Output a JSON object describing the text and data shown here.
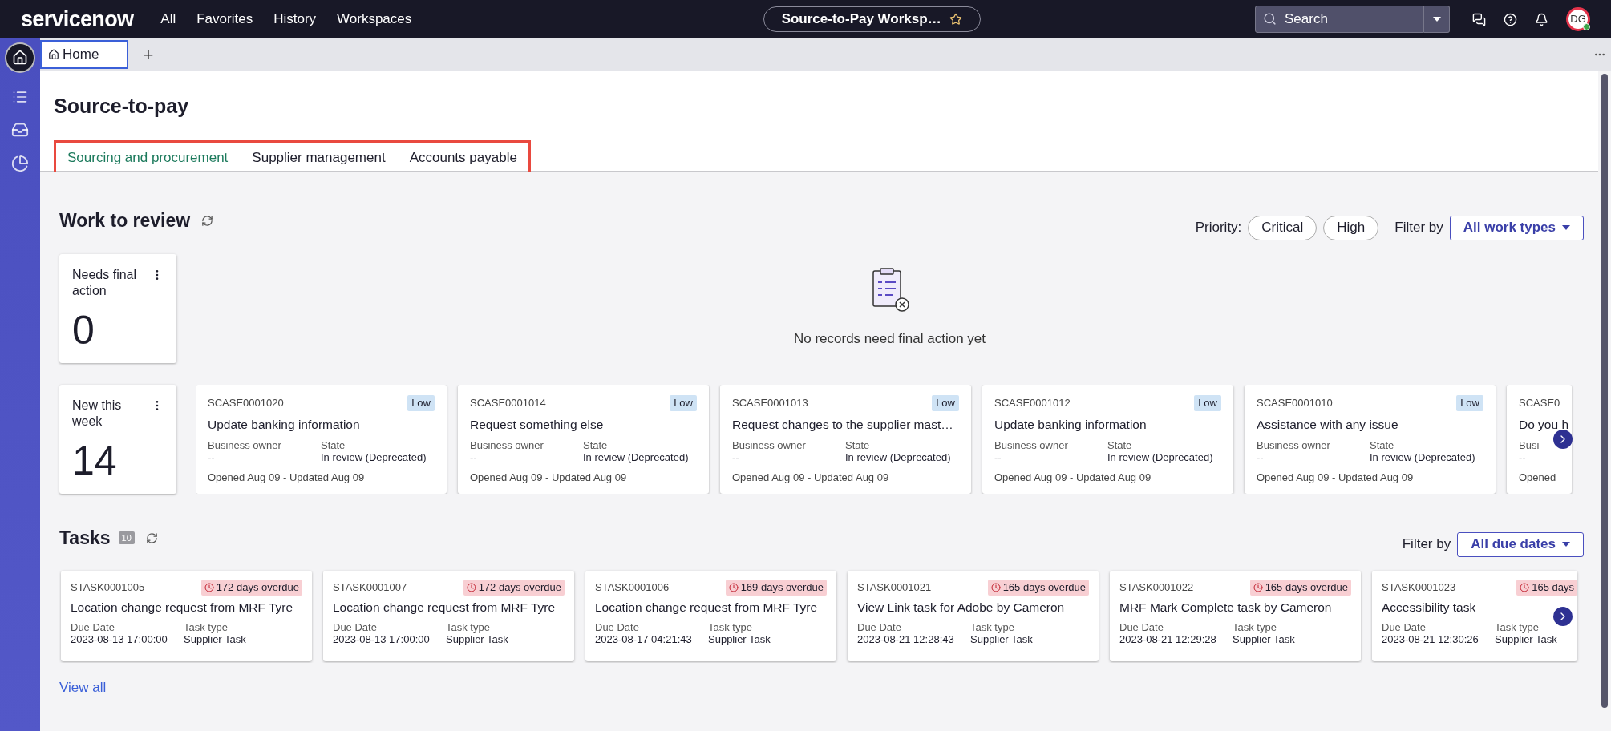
{
  "topbar": {
    "logo": "servicenow",
    "nav": [
      "All",
      "Favorites",
      "History",
      "Workspaces"
    ],
    "workspace": "Source-to-Pay Worksp…",
    "search": {
      "placeholder": "Search"
    },
    "avatar": "DG"
  },
  "tabstrip": {
    "tabs": [
      {
        "label": "Home",
        "selected": true
      }
    ],
    "add": "+"
  },
  "page": {
    "title": "Source-to-pay",
    "tabs": [
      {
        "label": "Sourcing and procurement",
        "selected": true
      },
      {
        "label": "Supplier management",
        "selected": false
      },
      {
        "label": "Accounts payable",
        "selected": false
      }
    ]
  },
  "work_to_review": {
    "title": "Work to review",
    "priority_label": "Priority:",
    "priority": [
      {
        "label": "Critical",
        "selected": false
      },
      {
        "label": "High",
        "selected": false
      }
    ],
    "filter_label": "Filter by",
    "filter": "All work types",
    "metrics": [
      {
        "label": "Needs final action",
        "value": "0"
      },
      {
        "label": "New this week",
        "value": "14"
      }
    ],
    "empty_message": "No records need final action yet",
    "cases": [
      {
        "id": "SCASE0001020",
        "priority": "Low",
        "title": "Update banking information",
        "owner_label": "Business owner",
        "owner": "--",
        "state_label": "State",
        "state": "In review (Deprecated)",
        "footer": "Opened Aug 09 - Updated Aug 09",
        "clipped": false
      },
      {
        "id": "SCASE0001014",
        "priority": "Low",
        "title": "Request something else",
        "owner_label": "Business owner",
        "owner": "--",
        "state_label": "State",
        "state": "In review (Deprecated)",
        "footer": "Opened Aug 09 - Updated Aug 09",
        "clipped": false
      },
      {
        "id": "SCASE0001013",
        "priority": "Low",
        "title": "Request changes to the supplier mast…",
        "owner_label": "Business owner",
        "owner": "--",
        "state_label": "State",
        "state": "In review (Deprecated)",
        "footer": "Opened Aug 09 - Updated Aug 09",
        "clipped": false
      },
      {
        "id": "SCASE0001012",
        "priority": "Low",
        "title": "Update banking information",
        "owner_label": "Business owner",
        "owner": "--",
        "state_label": "State",
        "state": "In review (Deprecated)",
        "footer": "Opened Aug 09 - Updated Aug 09",
        "clipped": false
      },
      {
        "id": "SCASE0001010",
        "priority": "Low",
        "title": "Assistance with any issue",
        "owner_label": "Business owner",
        "owner": "--",
        "state_label": "State",
        "state": "In review (Deprecated)",
        "footer": "Opened Aug 09 - Updated Aug 09",
        "clipped": false
      },
      {
        "id": "SCASE0",
        "title": "Do you h",
        "owner_label": "Busi",
        "owner": "--",
        "footer": "Opened",
        "clipped": true
      }
    ]
  },
  "tasks": {
    "title": "Tasks",
    "count": "10",
    "filter_label": "Filter by",
    "filter": "All due dates",
    "items": [
      {
        "id": "STASK0001005",
        "overdue": "172 days overdue",
        "title": "Location change request from MRF Tyre",
        "due_label": "Due Date",
        "due": "2023-08-13 17:00:00",
        "type_label": "Task type",
        "type": "Supplier Task",
        "clipped": false
      },
      {
        "id": "STASK0001007",
        "overdue": "172 days overdue",
        "title": "Location change request from MRF Tyre",
        "due_label": "Due Date",
        "due": "2023-08-13 17:00:00",
        "type_label": "Task type",
        "type": "Supplier Task",
        "clipped": false
      },
      {
        "id": "STASK0001006",
        "overdue": "169 days overdue",
        "title": "Location change request from MRF Tyre",
        "due_label": "Due Date",
        "due": "2023-08-17 04:21:43",
        "type_label": "Task type",
        "type": "Supplier Task",
        "clipped": false
      },
      {
        "id": "STASK0001021",
        "overdue": "165 days overdue",
        "title": "View Link task for Adobe by Cameron",
        "due_label": "Due Date",
        "due": "2023-08-21 12:28:43",
        "type_label": "Task type",
        "type": "Supplier Task",
        "clipped": false
      },
      {
        "id": "STASK0001022",
        "overdue": "165 days overdue",
        "title": "MRF Mark Complete task by Cameron",
        "due_label": "Due Date",
        "due": "2023-08-21 12:29:28",
        "type_label": "Task type",
        "type": "Supplier Task",
        "clipped": false
      },
      {
        "id": "STASK0001023",
        "overdue": "165 days",
        "title": "Accessibility task",
        "due_label": "Due Date",
        "due": "2023-08-21 12:30:26",
        "type_label": "Task type",
        "type": "Supplier Task",
        "clipped": true
      }
    ],
    "view_all": "View all"
  }
}
